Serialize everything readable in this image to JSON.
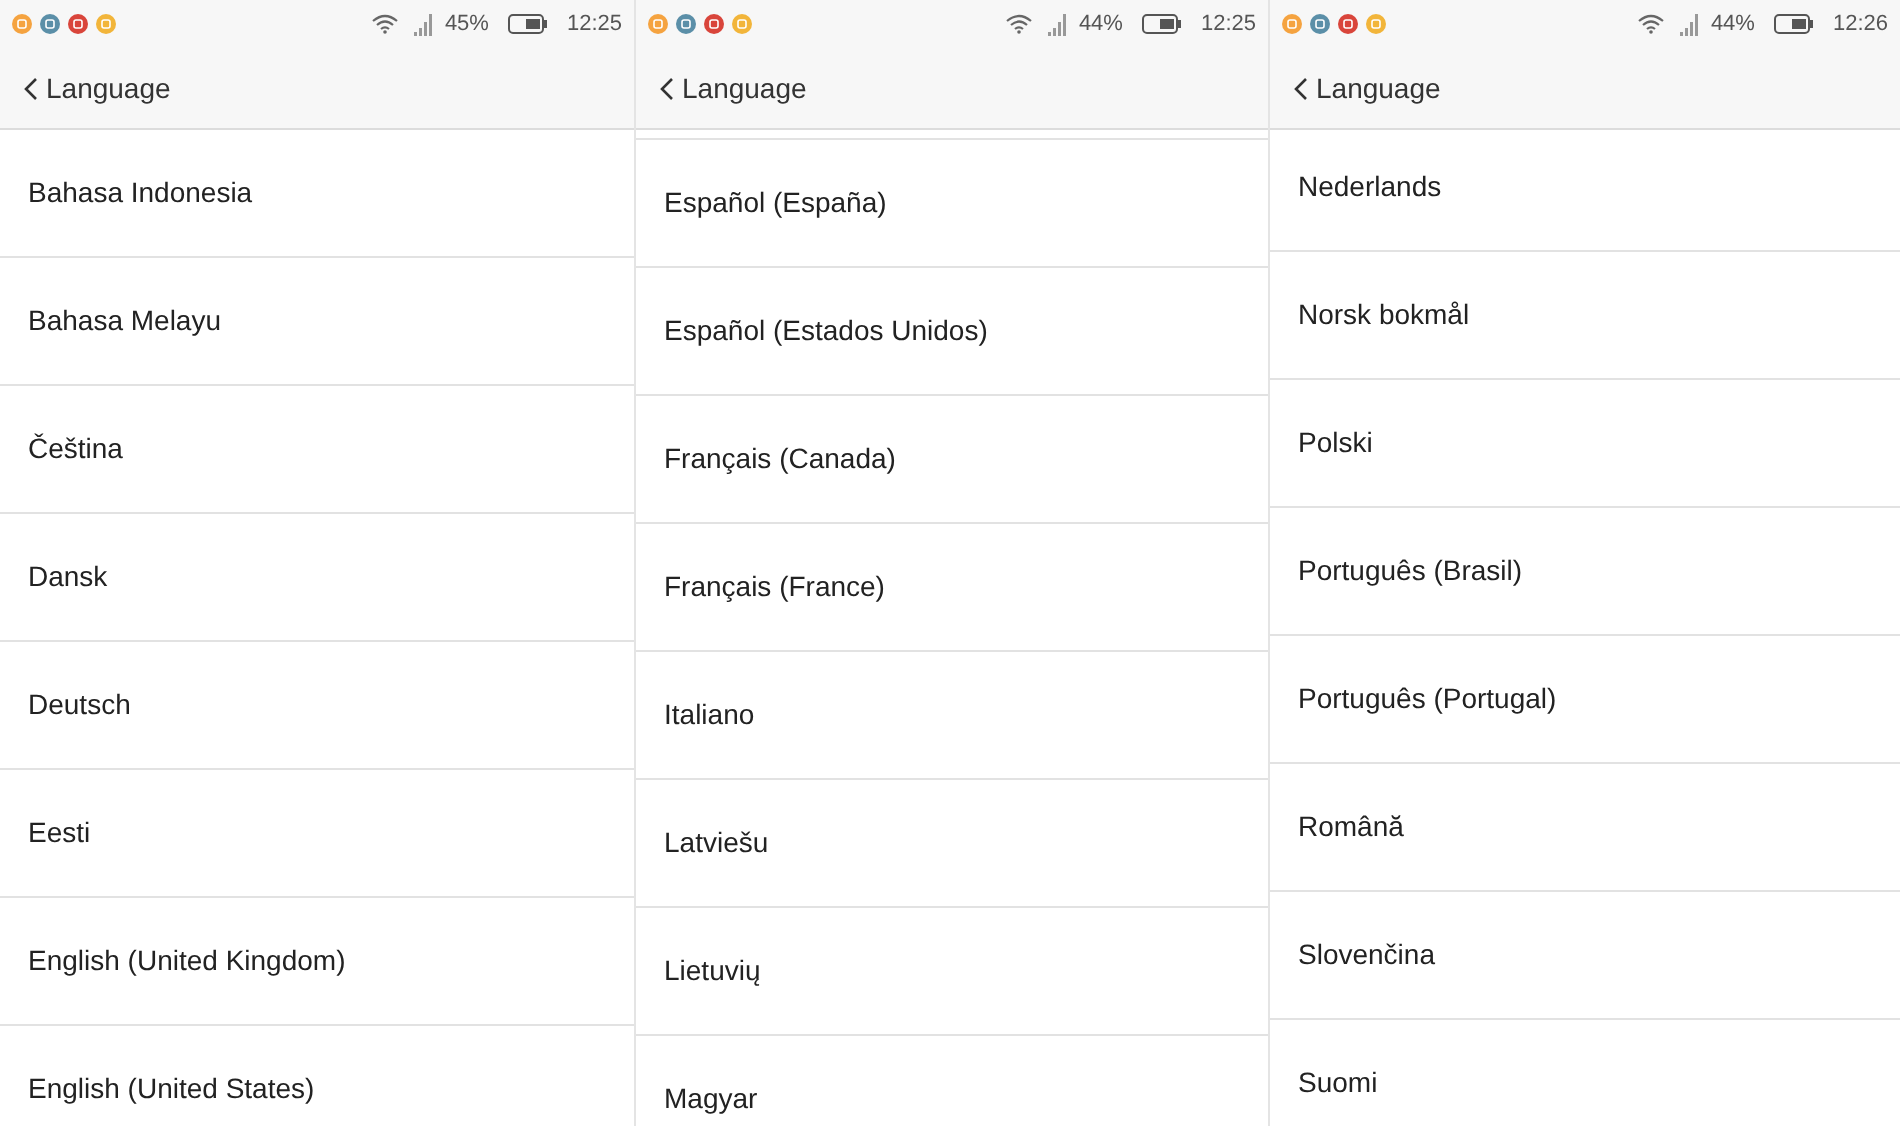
{
  "screens": [
    {
      "status_bar": {
        "battery": "45%",
        "time": "12:25"
      },
      "header": {
        "title": "Language"
      },
      "items": [
        "Bahasa Indonesia",
        "Bahasa Melayu",
        "Čeština",
        "Dansk",
        "Deutsch",
        "Eesti",
        "English (United Kingdom)",
        "English (United States)"
      ]
    },
    {
      "status_bar": {
        "battery": "44%",
        "time": "12:25"
      },
      "header": {
        "title": "Language"
      },
      "items": [
        "Español (España)",
        "Español (Estados Unidos)",
        "Français (Canada)",
        "Français (France)",
        "Italiano",
        "Latviešu",
        "Lietuvių",
        "Magyar"
      ]
    },
    {
      "status_bar": {
        "battery": "44%",
        "time": "12:26"
      },
      "header": {
        "title": "Language"
      },
      "items": [
        "Nederlands",
        "Norsk bokmål",
        "Polski",
        "Português (Brasil)",
        "Português (Portugal)",
        "Română",
        "Slovenčina",
        "Suomi"
      ]
    }
  ]
}
